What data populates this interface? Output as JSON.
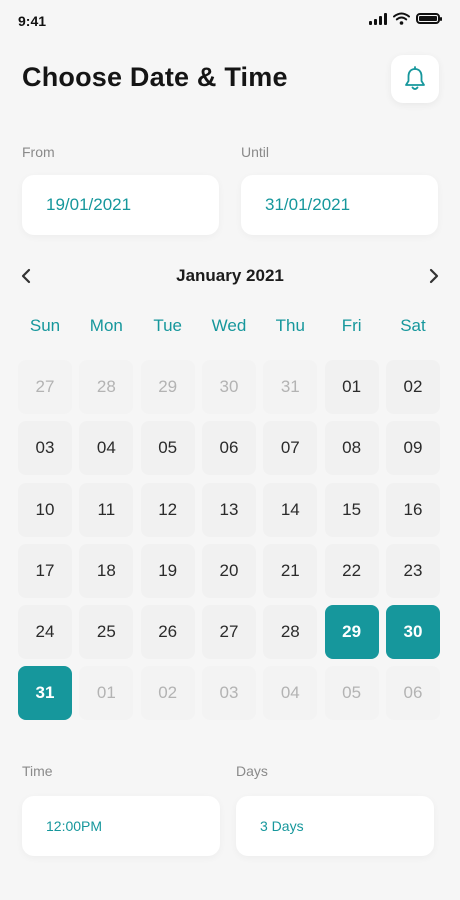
{
  "status": {
    "time": "9:41"
  },
  "header": {
    "title": "Choose Date & Time"
  },
  "range": {
    "from_label": "From",
    "from_value": "19/01/2021",
    "until_label": "Until",
    "until_value": "31/01/2021"
  },
  "calendar": {
    "month": "January 2021",
    "weekdays": [
      "Sun",
      "Mon",
      "Tue",
      "Wed",
      "Thu",
      "Fri",
      "Sat"
    ],
    "days": [
      {
        "label": "27",
        "state": "muted"
      },
      {
        "label": "28",
        "state": "muted"
      },
      {
        "label": "29",
        "state": "muted"
      },
      {
        "label": "30",
        "state": "muted"
      },
      {
        "label": "31",
        "state": "muted"
      },
      {
        "label": "01",
        "state": "normal"
      },
      {
        "label": "02",
        "state": "normal"
      },
      {
        "label": "03",
        "state": "normal"
      },
      {
        "label": "04",
        "state": "normal"
      },
      {
        "label": "05",
        "state": "normal"
      },
      {
        "label": "06",
        "state": "normal"
      },
      {
        "label": "07",
        "state": "normal"
      },
      {
        "label": "08",
        "state": "normal"
      },
      {
        "label": "09",
        "state": "normal"
      },
      {
        "label": "10",
        "state": "normal"
      },
      {
        "label": "11",
        "state": "normal"
      },
      {
        "label": "12",
        "state": "normal"
      },
      {
        "label": "13",
        "state": "normal"
      },
      {
        "label": "14",
        "state": "normal"
      },
      {
        "label": "15",
        "state": "normal"
      },
      {
        "label": "16",
        "state": "normal"
      },
      {
        "label": "17",
        "state": "normal"
      },
      {
        "label": "18",
        "state": "normal"
      },
      {
        "label": "19",
        "state": "normal"
      },
      {
        "label": "20",
        "state": "normal"
      },
      {
        "label": "21",
        "state": "normal"
      },
      {
        "label": "22",
        "state": "normal"
      },
      {
        "label": "23",
        "state": "normal"
      },
      {
        "label": "24",
        "state": "normal"
      },
      {
        "label": "25",
        "state": "normal"
      },
      {
        "label": "26",
        "state": "normal"
      },
      {
        "label": "27",
        "state": "normal"
      },
      {
        "label": "28",
        "state": "normal"
      },
      {
        "label": "29",
        "state": "selected"
      },
      {
        "label": "30",
        "state": "selected"
      },
      {
        "label": "31",
        "state": "selected"
      },
      {
        "label": "01",
        "state": "muted"
      },
      {
        "label": "02",
        "state": "muted"
      },
      {
        "label": "03",
        "state": "muted"
      },
      {
        "label": "04",
        "state": "muted"
      },
      {
        "label": "05",
        "state": "muted"
      },
      {
        "label": "06",
        "state": "muted"
      }
    ]
  },
  "details": {
    "time_label": "Time",
    "time_value": "12:00PM",
    "days_label": "Days",
    "days_value": "3 Days"
  },
  "icons": {
    "bell": "bell-icon",
    "prev": "chevron-left-icon",
    "next": "chevron-right-icon",
    "signal": "signal-icon",
    "wifi": "wifi-icon",
    "battery": "battery-icon"
  },
  "colors": {
    "accent": "#16979c",
    "background": "#f6f6f6",
    "card": "#ffffff"
  }
}
